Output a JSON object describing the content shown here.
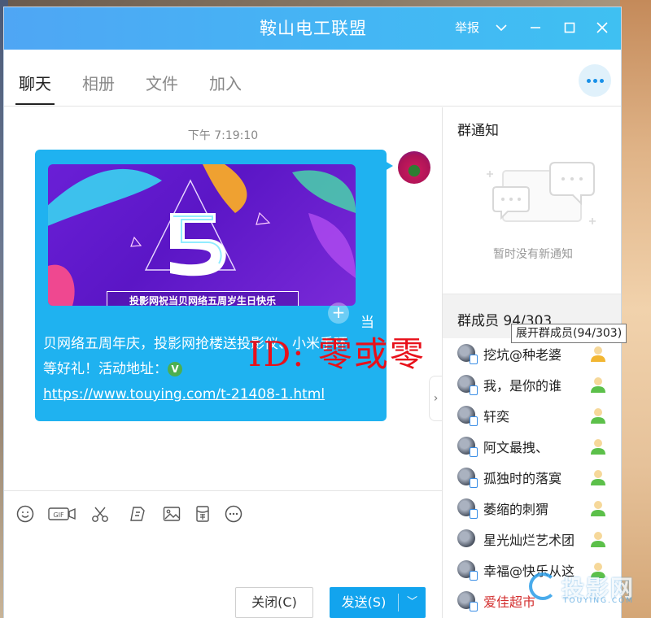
{
  "window": {
    "title": "鞍山电工联盟",
    "report_label": "举报"
  },
  "tabs": [
    {
      "label": "聊天",
      "active": true
    },
    {
      "label": "相册",
      "active": false
    },
    {
      "label": "文件",
      "active": false
    },
    {
      "label": "加入",
      "active": false
    }
  ],
  "chat": {
    "timestamp": "下午 7:19:10",
    "banner_digit": "5",
    "banner_caption": "投影网祝当贝网络五周岁生日快乐",
    "message_first": "当",
    "message_line1": "贝网络五周年庆，投影网抢楼送投影仪、小米手环",
    "message_line2": "等好礼！活动地址：",
    "message_link": "https://www.touying.com/t-21408-1.html",
    "verified_mark": "V",
    "watermark": "ID: 零或零"
  },
  "toolbar": {
    "gif_label": "GIF"
  },
  "buttons": {
    "close_label": "关闭(C)",
    "send_label": "发送(S)"
  },
  "notice": {
    "title": "群通知",
    "empty_text": "暂时没有新通知"
  },
  "members": {
    "title": "群成员 94/303",
    "tooltip": "展开群成员(94/303)",
    "list": [
      {
        "name": "挖坑@种老婆"
      },
      {
        "name": "我，是你的谁"
      },
      {
        "name": "轩奕"
      },
      {
        "name": "阿文最拽、"
      },
      {
        "name": "孤独时的落寞"
      },
      {
        "name": "萎缩的刺猬"
      },
      {
        "name": "星光灿烂艺术团"
      },
      {
        "name": "幸福@快乐从这"
      },
      {
        "name": "爱佳超市"
      }
    ]
  },
  "logo": {
    "text": "投影网",
    "sub": "TOUYING.COM"
  },
  "colors": {
    "titlebar": "#45b4f4",
    "bubble": "#1fb2f0",
    "send_button": "#12a4ee",
    "watermark_red": "#e8101a",
    "member_red": "#d32f2f"
  }
}
